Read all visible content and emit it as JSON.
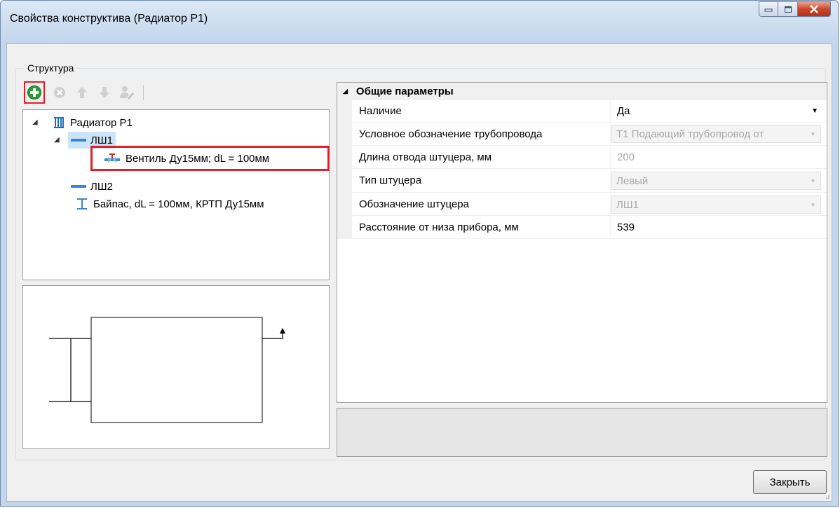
{
  "window": {
    "title": "Свойства конструктива (Радиатор Р1)",
    "controls": [
      "minimize",
      "maximize",
      "close"
    ]
  },
  "structure": {
    "label": "Структура",
    "toolbar": [
      {
        "icon": "add-icon",
        "enabled": true,
        "highlighted": true
      },
      {
        "icon": "delete-icon",
        "enabled": false
      },
      {
        "icon": "arrow-up-icon",
        "enabled": false
      },
      {
        "icon": "arrow-down-icon",
        "enabled": false
      },
      {
        "icon": "person-edit-icon",
        "enabled": false
      }
    ],
    "tree": {
      "root": "Радиатор Р1",
      "lsh1": "ЛШ1",
      "valve": "Вентиль Ду15мм; dL = 100мм",
      "lsh2": "ЛШ2",
      "bypass": "Байпас, dL = 100мм, КРТП Ду15мм"
    }
  },
  "properties": {
    "category": "Общие параметры",
    "rows": [
      {
        "name": "Наличие",
        "value": "Да"
      },
      {
        "name": "Условное обозначение трубопровода",
        "value": "Т1 Подающий трубопровод от"
      },
      {
        "name": "Длина отвода штуцера, мм",
        "value": "200"
      },
      {
        "name": "Тип штуцера",
        "value": "Левый"
      },
      {
        "name": "Обозначение штуцера",
        "value": "ЛШ1"
      },
      {
        "name": "Расстояние от низа прибора, мм",
        "value": "539"
      }
    ]
  },
  "buttons": {
    "close": "Закрыть"
  },
  "colors": {
    "highlight": "#e0202a",
    "selection": "#cce4f7",
    "add_green": "#2e9a3a"
  }
}
